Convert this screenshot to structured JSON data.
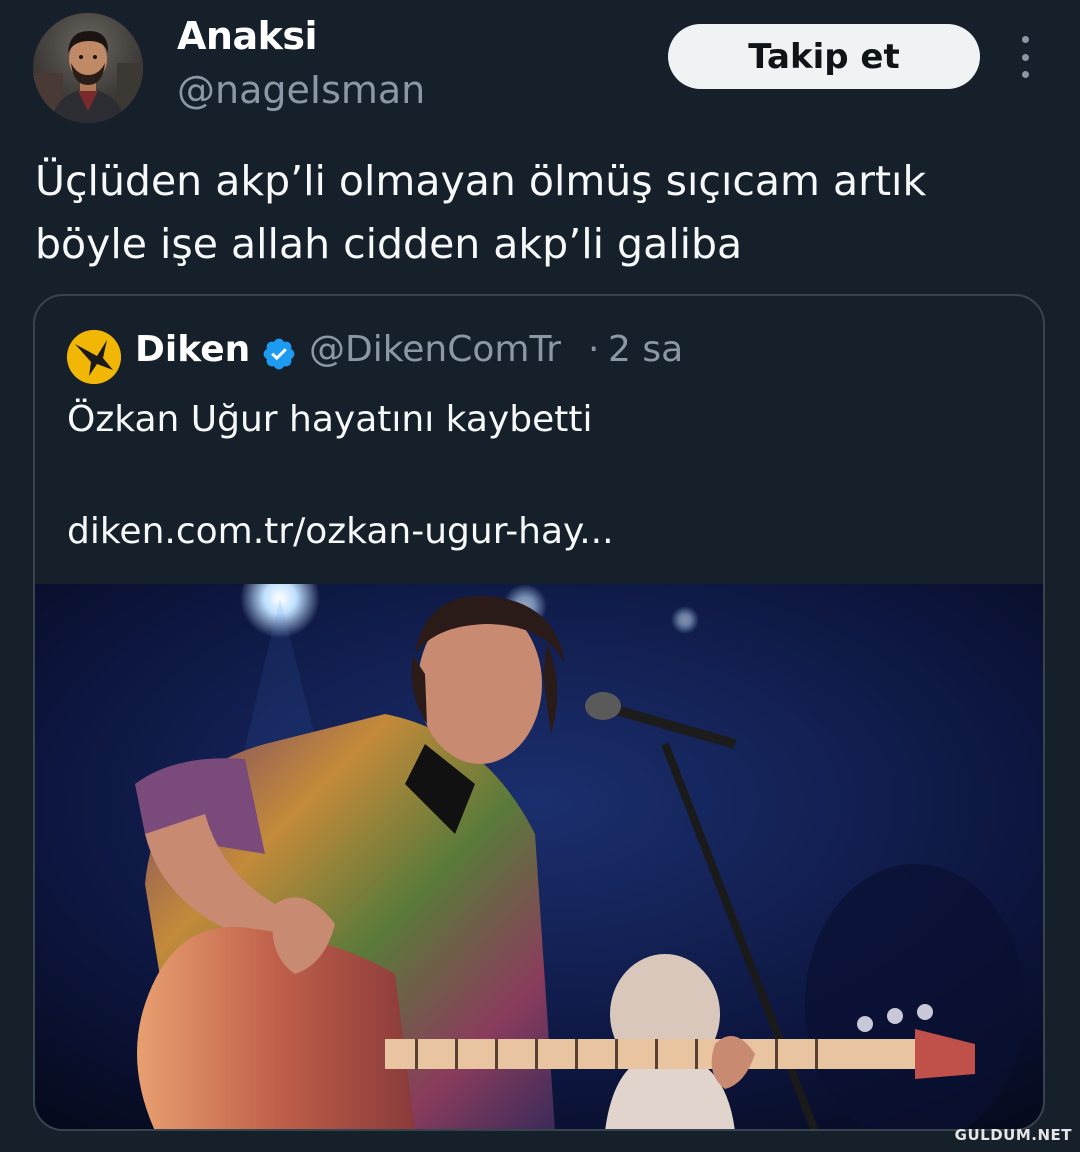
{
  "author": {
    "display_name": "Anaksi",
    "handle": "@nageIsman",
    "avatar_icon": "user-avatar-photo"
  },
  "actions": {
    "follow_label": "Takip et",
    "more_icon": "vertical-ellipsis-icon"
  },
  "tweet": {
    "text": "Üçlüden akp’li olmayan ölmüş sıçıcam artık\nböyle işe allah cidden akp’li galiba"
  },
  "quote": {
    "name": "Diken",
    "verified_icon": "verified-badge-icon",
    "handle": "@DikenComTr",
    "separator": "·",
    "time": "2 sa",
    "text": "Özkan Uğur hayatını kaybetti",
    "link": "diken.com.tr/ozkan-ugur-hay...",
    "image_icon": "concert-photo-bass-guitarist",
    "logo_icon": "diken-logo-icon"
  },
  "watermark": "GULDUM.NET",
  "colors": {
    "background": "#15202b",
    "secondary_text": "#8b98a5",
    "verified": "#1d9bf0",
    "border": "#38444d",
    "follow_button_bg": "#eff3f4",
    "diken_logo": "#f2b705"
  }
}
